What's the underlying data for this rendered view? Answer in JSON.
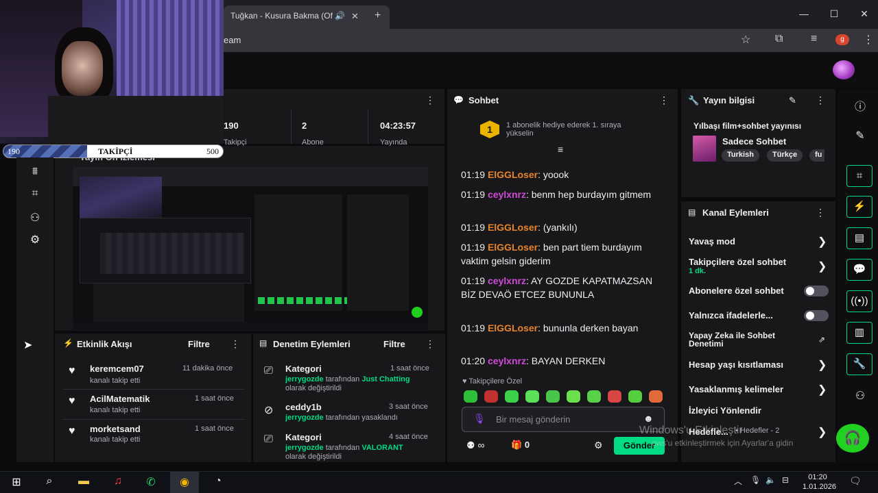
{
  "browser": {
    "tab_title": "Tuğkan - Kusura Bakma (Of",
    "tab_close": "✕",
    "new_tab": "+",
    "url_fragment": "eam",
    "profile_letter": "g",
    "window_controls": [
      "—",
      "☐",
      "✕"
    ]
  },
  "overlay": {
    "follow_current": "190",
    "follow_label": "TAKİPÇİ",
    "follow_goal": "500",
    "follow_progress": 0.38
  },
  "stats": {
    "items": [
      {
        "value": "190",
        "label": "Takipçi"
      },
      {
        "value": "2",
        "label": "Abone"
      },
      {
        "value": "04:23:57",
        "label": "Yayında"
      }
    ]
  },
  "preview": {
    "title": "Yayın Ön İzlemesi"
  },
  "activity": {
    "title": "Etkinlik Akışı",
    "filter": "Filtre",
    "items": [
      {
        "name": "keremcem07",
        "sub": "kanalı takip etti",
        "time": "11 dakika önce"
      },
      {
        "name": "AcilMatematik",
        "sub": "kanalı takip etti",
        "time": "1 saat önce"
      },
      {
        "name": "morketsand",
        "sub": "kanalı takip etti",
        "time": "1 saat önce"
      }
    ]
  },
  "moderation": {
    "title": "Denetim Eylemleri",
    "filter": "Filtre",
    "items": [
      {
        "title": "Kategori",
        "user": "jerrygozde",
        "mid": "tarafından",
        "value": "Just Chatting",
        "tail": "olarak değiştirildi",
        "time": "1 saat önce"
      },
      {
        "title": "ceddy1b",
        "user": "jerrygozde",
        "mid": "tarafından yasaklandı",
        "value": "",
        "tail": "",
        "time": "3 saat önce"
      },
      {
        "title": "Kategori",
        "user": "jerrygozde",
        "mid": "tarafından",
        "value": "VALORANT",
        "tail": "olarak değiştirildi",
        "time": "4 saat önce"
      }
    ]
  },
  "chat": {
    "title": "Sohbet",
    "hype_level": "1",
    "hype_text_1": "1 abonelik hediye ederek 1. sıraya",
    "hype_text_2": "yükselin",
    "messages": [
      {
        "time": "01:19",
        "user": "ElGGLoser",
        "text": ": yoook",
        "color": "u1"
      },
      {
        "time": "01:19",
        "user": "ceylxnrz",
        "text": ": benm hep burdayım gitmem",
        "color": "u2"
      },
      {
        "time": "01:19",
        "user": "ElGGLoser",
        "text": ": (yankılı)",
        "color": "u1"
      },
      {
        "time": "01:19",
        "user": "ElGGLoser",
        "text": ": ben part tiem burdayım vaktim gelsin giderim",
        "color": "u1"
      },
      {
        "time": "01:19",
        "user": "ceylxnrz",
        "text": ": AY GOZDE KAPATMAZSAN BİZ DEVAÖ ETCEZ BUNUNLA",
        "color": "u2"
      },
      {
        "time": "01:19",
        "user": "ElGGLoser",
        "text": ": bununla derken bayan",
        "color": "u1"
      },
      {
        "time": "01:20",
        "user": "ceylxnrz",
        "text": ": BAYAN DERKEN",
        "color": "u2"
      }
    ],
    "followers_only": "Takipçilere Özel",
    "placeholder": "Bir mesaj gönderin",
    "points": "0",
    "send": "Gönder"
  },
  "stream_info": {
    "title": "Yayın bilgisi",
    "stream_title": "Yılbaşı film+sohbet yayınısı",
    "category": "Sadece Sohbet",
    "tags": [
      "Turkish",
      "Türkçe",
      "fu"
    ]
  },
  "channel_actions": {
    "title": "Kanal Eylemleri",
    "items": [
      {
        "label": "Yavaş mod",
        "kind": "chevron"
      },
      {
        "label": "Takipçilere özel sohbet",
        "sub": "1 dk.",
        "kind": "chevron"
      },
      {
        "label": "Abonelere özel sohbet",
        "kind": "toggle"
      },
      {
        "label": "Yalnızca ifadelerle...",
        "kind": "toggle"
      },
      {
        "label": "Yapay Zeka ile Sohbet Denetimi",
        "kind": "external"
      },
      {
        "label": "Hesap yaşı kısıtlaması",
        "kind": "chevron"
      },
      {
        "label": "Yasaklanmış kelimeler",
        "kind": "chevron"
      },
      {
        "label": "İzleyici Yönlendir",
        "kind": "none"
      },
      {
        "label": "Hedefle...",
        "extra": "• Hedefler - 2",
        "kind": "chevron"
      }
    ]
  },
  "watermark": {
    "line1": "Windows'u Etkinleştir",
    "line2": "ows'u etkinleştirmek için Ayarlar'a gidin"
  },
  "taskbar": {
    "time": "01:20",
    "date": "1.01.2026"
  },
  "colors": {
    "accent": "#00db84",
    "chat_user_orange": "#e7852b",
    "chat_user_purple": "#d14ad6",
    "panel_bg": "#18181b"
  }
}
